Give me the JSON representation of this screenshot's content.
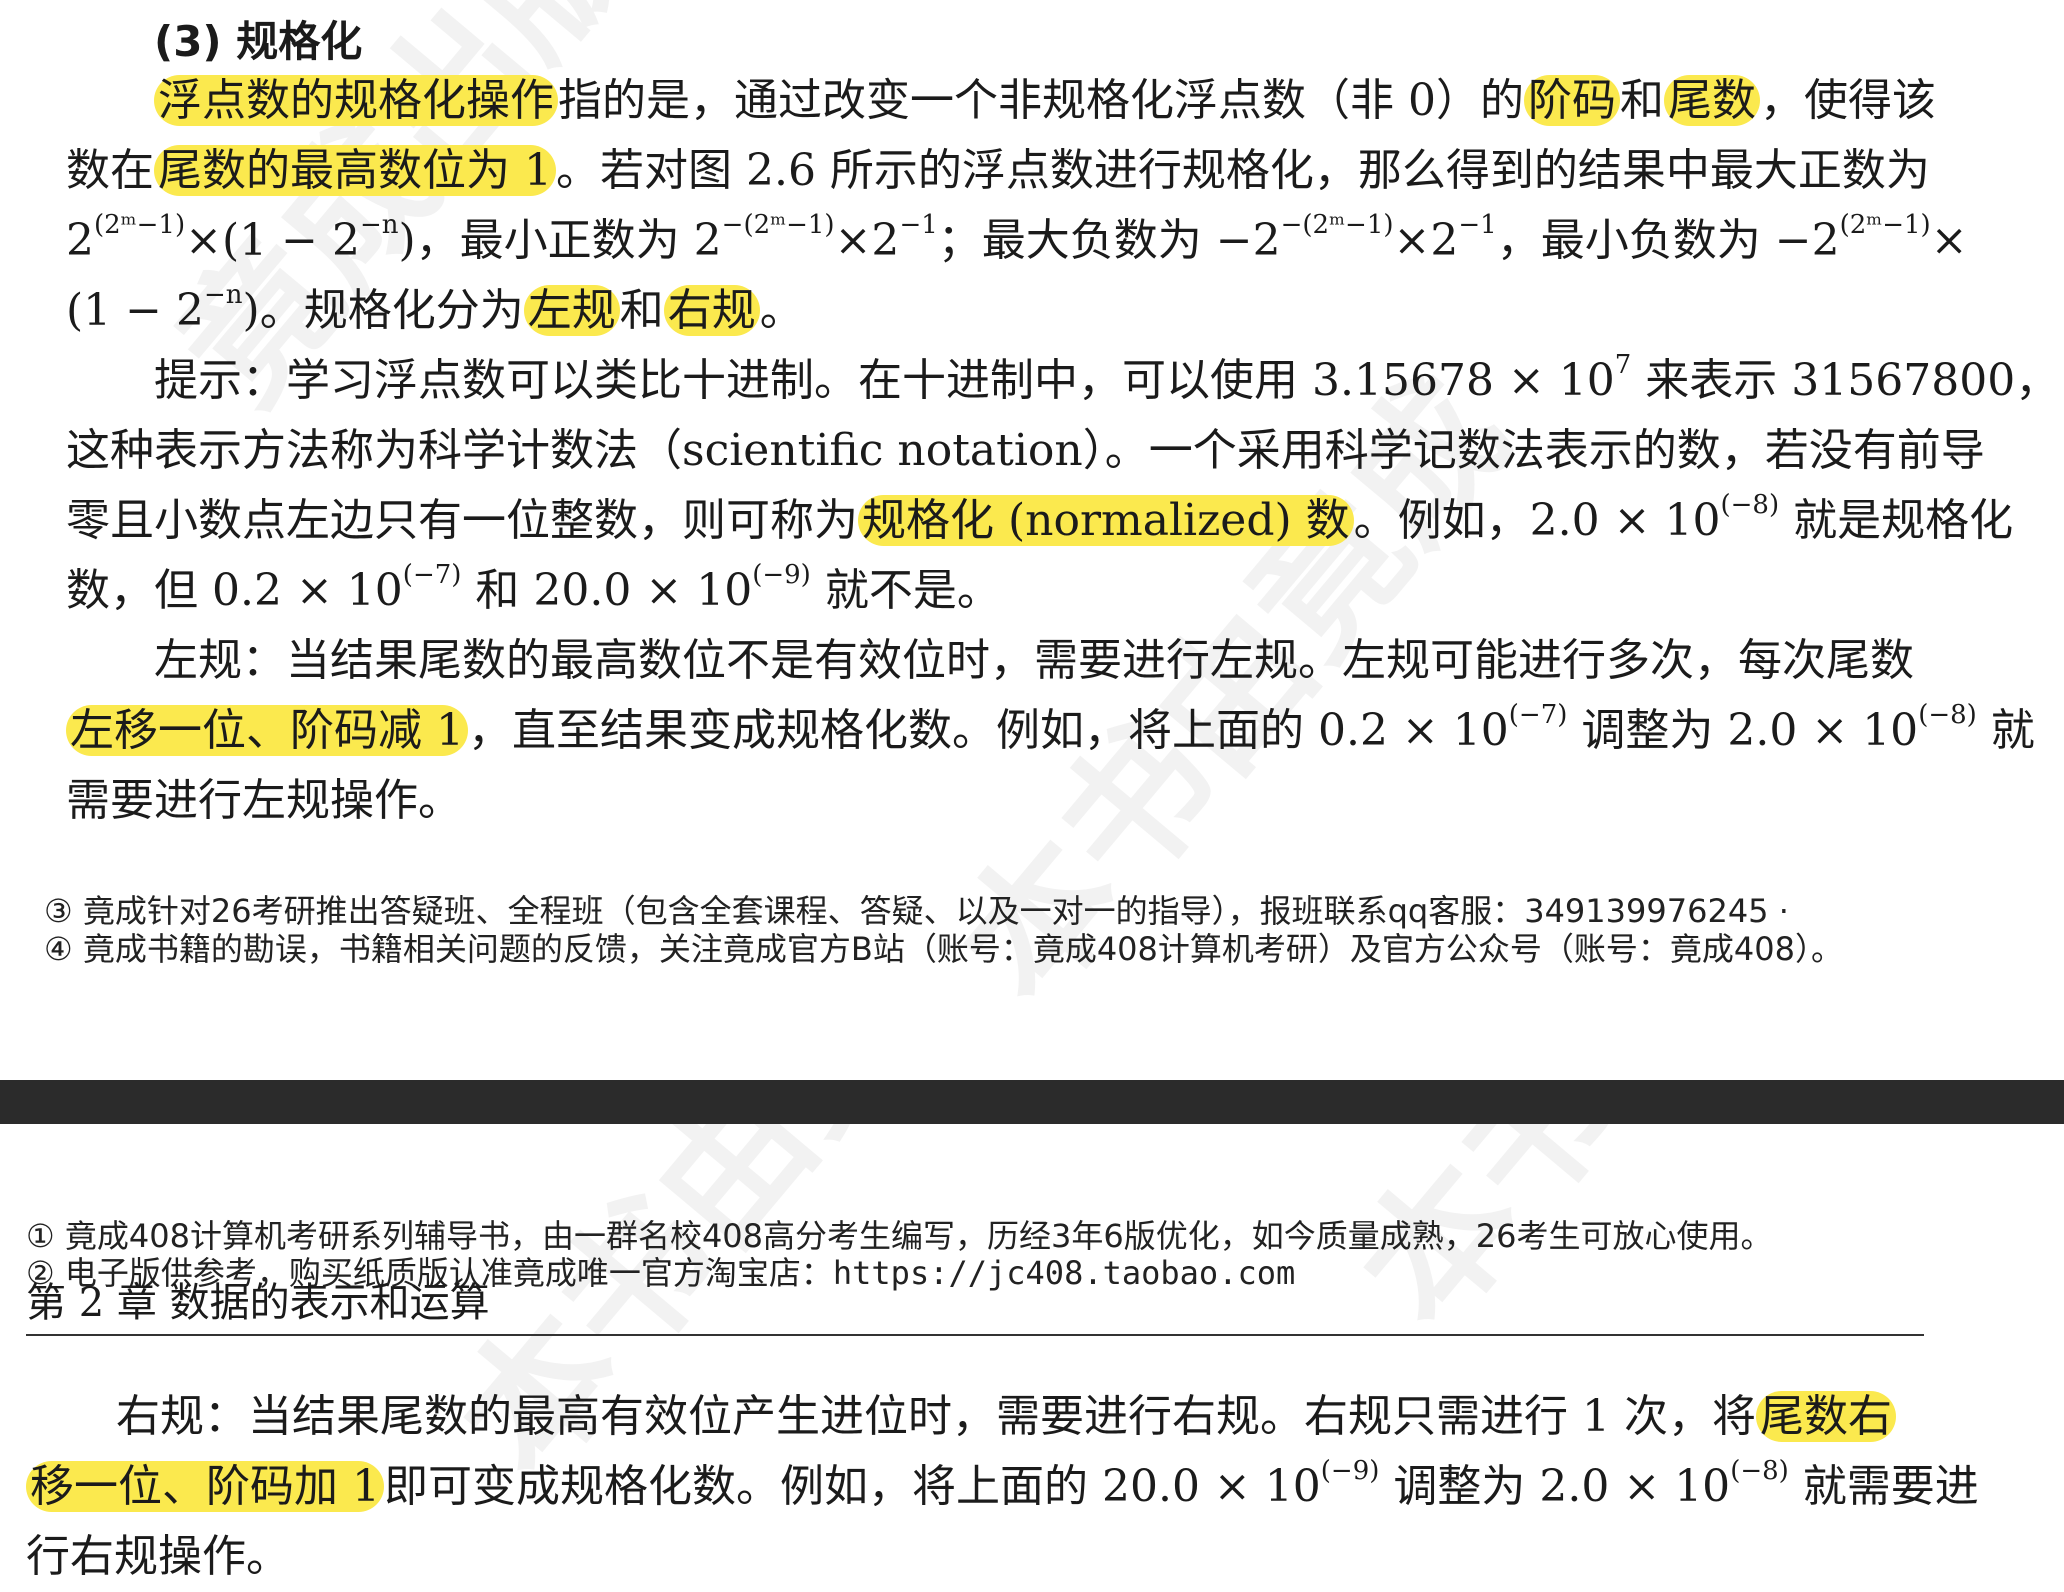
{
  "section_heading": "(3) 规格化",
  "normalization_para": {
    "l1_hl1": "浮点数的规格化操作",
    "l1_a": "指的是，通过改变一个非规格化浮点数（非 0）的",
    "l1_hl2": "阶码",
    "l1_b": "和",
    "l1_hl3": "尾数",
    "l1_c": "，使得该",
    "l2_a": "数在",
    "l2_hl": "尾数的最高数位为 1",
    "l2_b": "。若对图 2.6 所示的浮点数进行规格化，那么得到的结果中最大正数为",
    "l3_a": "2",
    "l3_sup1": "(2ᵐ−1)",
    "l3_b": "×(1 − 2",
    "l3_sup2": "−n",
    "l3_c": ")，最小正数为 2",
    "l3_sup3": "−(2ᵐ−1)",
    "l3_d": "×2",
    "l3_sup4": "−1",
    "l3_e": "；最大负数为 −2",
    "l3_sup5": "−(2ᵐ−1)",
    "l3_f": "×2",
    "l3_sup6": "−1",
    "l3_g": "，最小负数为 −2",
    "l3_sup7": "(2ᵐ−1)",
    "l3_h": "×",
    "l4_a": "(1 − 2",
    "l4_sup": "−n",
    "l4_b": ")。规格化分为",
    "l4_hl1": "左规",
    "l4_c": "和",
    "l4_hl2": "右规",
    "l4_d": "。"
  },
  "hint_para": {
    "l1_a": "提示：学习浮点数可以类比十进制。在十进制中，可以使用 3.15678 × 10",
    "l1_sup": "7",
    "l1_b": " 来表示 31567800，",
    "l2": "这种表示方法称为科学计数法（scientific notation）。一个采用科学记数法表示的数，若没有前导",
    "l3_a": "零且小数点左边只有一位整数，则可称为",
    "l3_hl": "规格化 (normalized) 数",
    "l3_b": "。例如，2.0 × 10",
    "l3_sup": "(−8)",
    "l3_c": " 就是规格化",
    "l4_a": "数，但 0.2 × 10",
    "l4_sup1": "(−7)",
    "l4_b": " 和 20.0 × 10",
    "l4_sup2": "(−9)",
    "l4_c": " 就不是。"
  },
  "left_para": {
    "l1": "左规：当结果尾数的最高数位不是有效位时，需要进行左规。左规可能进行多次，每次尾数",
    "l2_hl": "左移一位、阶码减 1",
    "l2_a": "，直至结果变成规格化数。例如，将上面的 0.2 × 10",
    "l2_sup1": "(−7)",
    "l2_b": " 调整为 2.0 × 10",
    "l2_sup2": "(−8)",
    "l2_c": " 就",
    "l3": "需要进行左规操作。"
  },
  "footnotes_top": {
    "n3": "③ 竟成针对26考研推出答疑班、全程班（包含全套课程、答疑、以及一对一的指导），报班联系qq客服：3491399762",
    "page_num": "45",
    "n3_tail": " ·",
    "n4": "④ 竟成书籍的勘误，书籍相关问题的反馈，关注竟成官方B站（账号：竟成408计算机考研）及官方公众号（账号：竟成408）。"
  },
  "footnotes_bottom": {
    "n1": "① 竟成408计算机考研系列辅导书，由一群名校408高分考生编写，历经3年6版优化，如今质量成熟，26考生可放心使用。",
    "n2_a": "② 电子版供参考，购买纸质版认准竟成唯一官方淘宝店：",
    "n2_url": "https://jc408.taobao.com"
  },
  "chapter_header": "第 2 章  数据的表示和运算",
  "right_para": {
    "l1_a": "右规：当结果尾数的最高有效位产生进位时，需要进行右规。右规只需进行 1 次，将",
    "l1_hl": "尾数右",
    "l2_hl": "移一位、阶码加 1",
    "l2_a": "即可变成规格化数。例如，将上面的 20.0 × 10",
    "l2_sup1": "(−9)",
    "l2_b": " 调整为 2.0 × 10",
    "l2_sup2": "(−8)",
    "l2_c": " 就需要进",
    "l3": "行右规操作。"
  },
  "colors": {
    "highlight": "#fbe94e",
    "separator": "#2b2b2b"
  }
}
